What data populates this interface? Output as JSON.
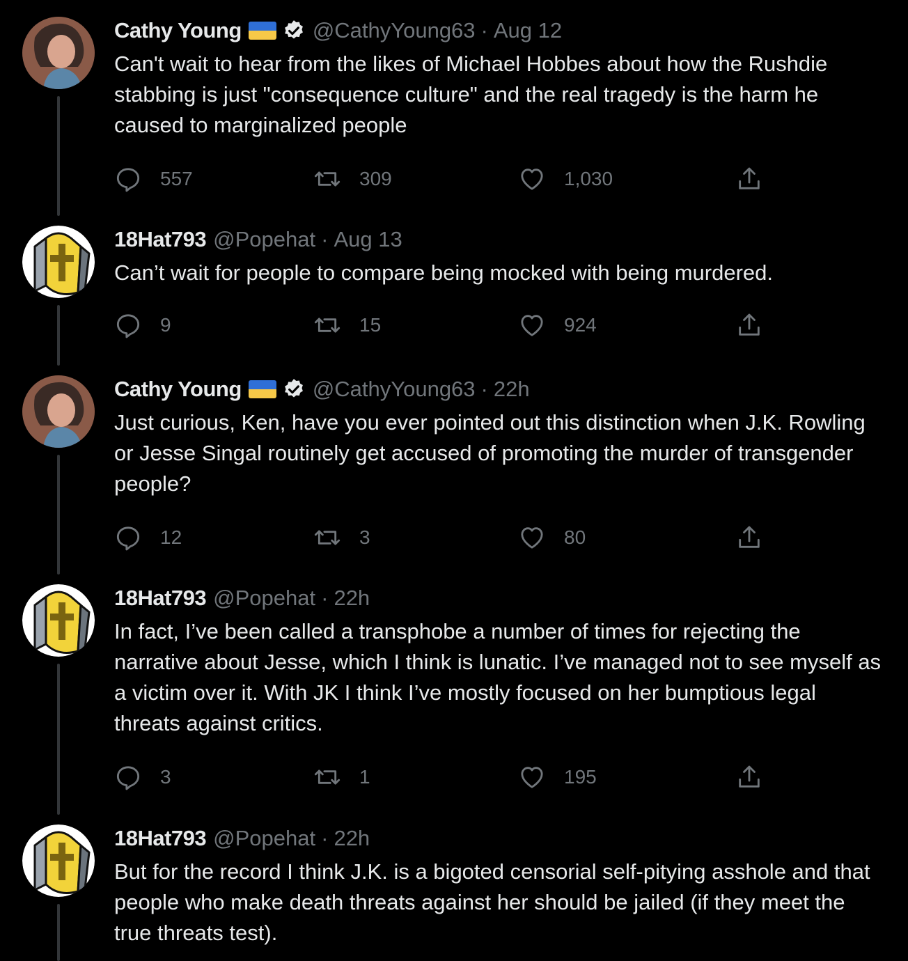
{
  "tweets": [
    {
      "name": "Cathy Young",
      "handle": "@CathyYoung63",
      "separator": "·",
      "time": "Aug 12",
      "text": "Can't wait to hear from the likes of Michael Hobbes about how the Rushdie stabbing is just \"consequence culture\" and the real tragedy is the harm he caused to marginalized people",
      "replies": "557",
      "retweets": "309",
      "likes": "1,030"
    },
    {
      "name": "18Hat793",
      "handle": "@Popehat",
      "separator": "·",
      "time": "Aug 13",
      "text": "Can’t wait for people to compare being mocked with being murdered.",
      "replies": "9",
      "retweets": "15",
      "likes": "924"
    },
    {
      "name": "Cathy Young",
      "handle": "@CathyYoung63",
      "separator": "·",
      "time": "22h",
      "text": "Just curious, Ken, have you ever pointed out this distinction when J.K. Rowling or Jesse Singal routinely get accused of promoting the murder of transgender people?",
      "replies": "12",
      "retweets": "3",
      "likes": "80"
    },
    {
      "name": "18Hat793",
      "handle": "@Popehat",
      "separator": "·",
      "time": "22h",
      "text": "In fact, I’ve been called a transphobe a number of times for rejecting the narrative about Jesse, which I think is lunatic. I’ve managed not to see myself as a victim over it. With JK I think I’ve mostly focused on her bumptious legal threats against critics.",
      "replies": "3",
      "retweets": "1",
      "likes": "195"
    },
    {
      "name": "18Hat793",
      "handle": "@Popehat",
      "separator": "·",
      "time": "22h",
      "text": "But for the record I think J.K. is a bigoted censorial self-pitying asshole and that people who make death threats against her should be jailed (if they meet the true threats test)."
    }
  ],
  "colors": {
    "background": "#000000",
    "primary_text": "#e7e9ea",
    "secondary_text": "#71767b",
    "thread_line": "#333639",
    "flag_blue": "#2f6fd6",
    "flag_yellow": "#f7c948"
  },
  "icons": [
    "reply-icon",
    "retweet-icon",
    "like-icon",
    "share-icon",
    "verified-icon",
    "ukraine-flag-icon"
  ]
}
